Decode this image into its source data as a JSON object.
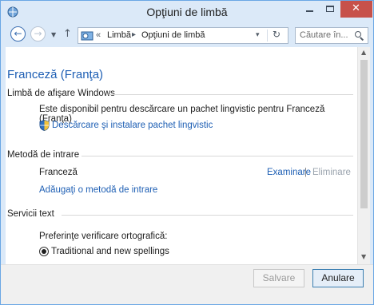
{
  "window": {
    "title": "Opţiuni de limbă"
  },
  "addressbar": {
    "overflow": "«",
    "crumbs": [
      "Limbă",
      "Opţiuni de limbă"
    ],
    "search_placeholder": "Căutare în..."
  },
  "content": {
    "language_title": "Franceză (Franţa)",
    "display_language": {
      "heading": "Limbă de afişare Windows",
      "message": "Este disponibil pentru descărcare un pachet lingvistic pentru Franceză (Franţa)",
      "download_link": "Descărcare şi instalare pachet lingvistic"
    },
    "input_method": {
      "heading": "Metodă de intrare",
      "method_name": "Franceză",
      "examine_link": "Examinare",
      "separator": "|",
      "remove_link": "Eliminare",
      "add_link": "Adăugaţi o metodă de intrare"
    },
    "text_services": {
      "heading": "Servicii text",
      "spelling_label": "Preferinţe verificare ortografică:",
      "spelling_option": "Traditional and new spellings"
    }
  },
  "footer": {
    "save_label": "Salvare",
    "cancel_label": "Anulare"
  },
  "colors": {
    "link": "#1e5fb4",
    "close_button": "#c7514a",
    "window_frame": "#dbe9f8"
  }
}
